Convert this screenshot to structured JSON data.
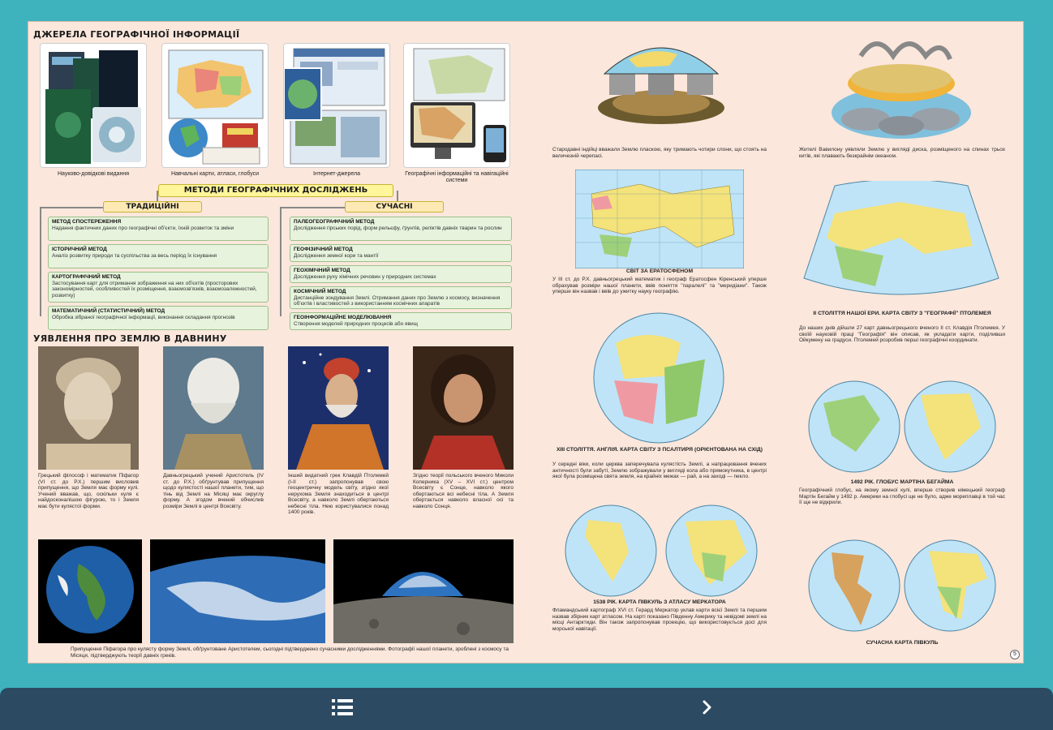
{
  "page": {
    "number": "5",
    "sources": {
      "title": "ДЖЕРЕЛА ГЕОГРАФІЧНОЇ ІНФОРМАЦІЇ",
      "items": [
        {
          "caption": "Науково-довідкові видання"
        },
        {
          "caption": "Навчальні карти, атласи, глобуси"
        },
        {
          "caption": "Інтернет-джерела"
        },
        {
          "caption": "Географічні інформаційні та навігаційні системи"
        }
      ]
    },
    "methods": {
      "title": "МЕТОДИ ГЕОГРАФІЧНИХ ДОСЛІДЖЕНЬ",
      "traditional_label": "ТРАДИЦІЙНІ",
      "modern_label": "СУЧАСНІ",
      "traditional": [
        {
          "name": "МЕТОД СПОСТЕРЕЖЕННЯ",
          "desc": "Надання фактичних даних про географічні об'єкти, їхній розвиток та зміни"
        },
        {
          "name": "ІСТОРИЧНИЙ МЕТОД",
          "desc": "Аналіз розвитку природи та суспільства за весь період їх існування"
        },
        {
          "name": "КАРТОГРАФІЧНИЙ МЕТОД",
          "desc": "Застосування карт для отримання зображення на них об'єктів (просторових закономірностей, особливостей їх розміщення, взаємозв'язків, взаємозалежностей, розвитку)"
        },
        {
          "name": "МАТЕМАТИЧНИЙ (СТАТИСТИЧНИЙ) МЕТОД",
          "desc": "Обробка зібраної географічної інформації, виконання складання прогнозів"
        }
      ],
      "modern": [
        {
          "name": "ПАЛЕОГЕОГРАФІЧНИЙ МЕТОД",
          "desc": "Дослідження гірських порід, форм рельєфу, ґрунтів, реліктів давніх тварин та рослин"
        },
        {
          "name": "ГЕОФІЗИЧНИЙ МЕТОД",
          "desc": "Дослідження земної кори та мантії"
        },
        {
          "name": "ГЕОХІМІЧНИЙ МЕТОД",
          "desc": "Дослідження руху хімічних речовин у природних системах"
        },
        {
          "name": "КОСМІЧНИЙ МЕТОД",
          "desc": "Дистанційне зондування Землі. Отримання даних про Землю з космосу, визначення об'єктів і властивостей з використанням космічних апаратів"
        },
        {
          "name": "ГЕОІНФОРМАЦІЙНЕ МОДЕЛЮВАННЯ",
          "desc": "Створення моделей природних процесів або явищ"
        }
      ]
    },
    "ancient": {
      "title": "УЯВЛЕННЯ ПРО ЗЕМЛЮ В ДАВНИНУ",
      "people": [
        {
          "text": "Грецький філософ і математик Піфагор (VI ст. до Р.Х.) першим висловив припущення, що Земля має форму кулі. Учений вважав, що, оскільки куля є найдосконалішою фігурою, то і Земля має бути кулястої форми."
        },
        {
          "text": "Давньогрецький учений Аристотель (IV ст. до Р.Х.) обґрунтував припущення щодо кулястості нашої планети, тим, що тінь від Землі на Місяці має округлу форму. А згодом вчений обчислив розміри Землі в центрі Всесвіту."
        },
        {
          "text": "Інший видатний грек Клавдій Птолемей (I-II ст.) запропонував свою геоцентричну модель світу, згідно якої нерухома Земля знаходиться в центрі Всесвіту, а навколо Землі обертаються небесні тіла. Нею користувалися понад 1400 років."
        },
        {
          "text": "Згідно теорії польського вченого Миколи Коперника (XV – XVI ст.) центром Всесвіту є Сонце, навколо якого обертаються всі небесні тіла. А Земля обертається навколо власної осі та навколо Сонця."
        }
      ],
      "bottom_text": "Припущення Піфагора про кулясту форму Землі, обґрунтоване Аристотелем, сьогодні підтверджено сучасними дослідженнями. Фотографії нашої планети, зроблені з космосу та Місяця, підтверджують теорії давніх греків."
    },
    "maps_center": [
      {
        "caption": "",
        "text": "Стародавні індійці вважали Землю пласкою, яку тримають чотири слони, що стоять на величезній черепасі."
      },
      {
        "caption": "СВІТ ЗА ЕРАТОСФЕНОМ",
        "text": "У III ст. до Р.Х. давньогрецький математик і географ Ератосфен Кіренський уперше обрахував розміри нашої планети, ввів поняття \"паралелі\" та \"меридіани\". Також уперше він назвав і ввів до ужитку науку географію."
      },
      {
        "caption": "XIII СТОЛІТТЯ. АНГЛІЯ. КАРТА СВІТУ З ПСАЛТИРЯ (ОРІЄНТОВАНА НА СХІД)",
        "text": "У середні віки, коли церква заперечувала кулястість Землі, а напрацювання вчених античності були забуті, Землю зображували у вигляді кола або прямокутника, в центрі якої була розміщена свята земля, на крайніх межах — рай, а на заході — пекло."
      },
      {
        "caption": "1538 РІК. КАРТА ПІВКУЛЬ З АТЛАСУ МЕРКАТОРА",
        "text": "Фламандський картограф XVI ст. Герард Меркатор уклав карти всієї Землі та першим назвав збірник карт атласом. На карті показано Південну Америку та невідомі землі на місці Антарктиди. Він також запропонував проекцію, що використовується досі для морської навігації."
      }
    ],
    "maps_right": [
      {
        "caption": "",
        "text": "Жителі Вавилону уявляли Землю у вигляді диска, розміщеного на спинах трьох китів, які плавають безкрайнім океаном."
      },
      {
        "caption": "II СТОЛІТТЯ НАШОЇ ЕРИ. КАРТА СВІТУ З \"ГЕОГРАФІЇ\" ПТОЛЕМЕЯ",
        "text": "До наших днів дійшли 27 карт давньогрецького вченого II ст. Клавдія Птолемея. У своїй науковій праці \"Географія\" він описав, як укладати карти, поділивши Ойкумену на градуси. Птолемей розробив перші географічні координати."
      },
      {
        "caption": "1492 РІК. ГЛОБУС МАРТІНА БЕГАЙМА",
        "text": "Географічний глобус, на якому земної кулі, вперше створив німецький географ Мартін Бегайм у 1492 р. Америки на глобусі ще не було, адже мореплавці в той час її ще не відкрили."
      },
      {
        "caption": "СУЧАСНА КАРТА ПІВКУЛЬ",
        "text": ""
      }
    ]
  },
  "nav": {
    "menu_icon": "list-icon",
    "next_icon": "chevron-right-icon"
  },
  "colors": {
    "frame": "#3fb3bd",
    "page": "#fbe7dc",
    "nav_bar": "#2d4a63",
    "methods_box": "#e7f3dd",
    "methods_title": "#fff59a"
  }
}
